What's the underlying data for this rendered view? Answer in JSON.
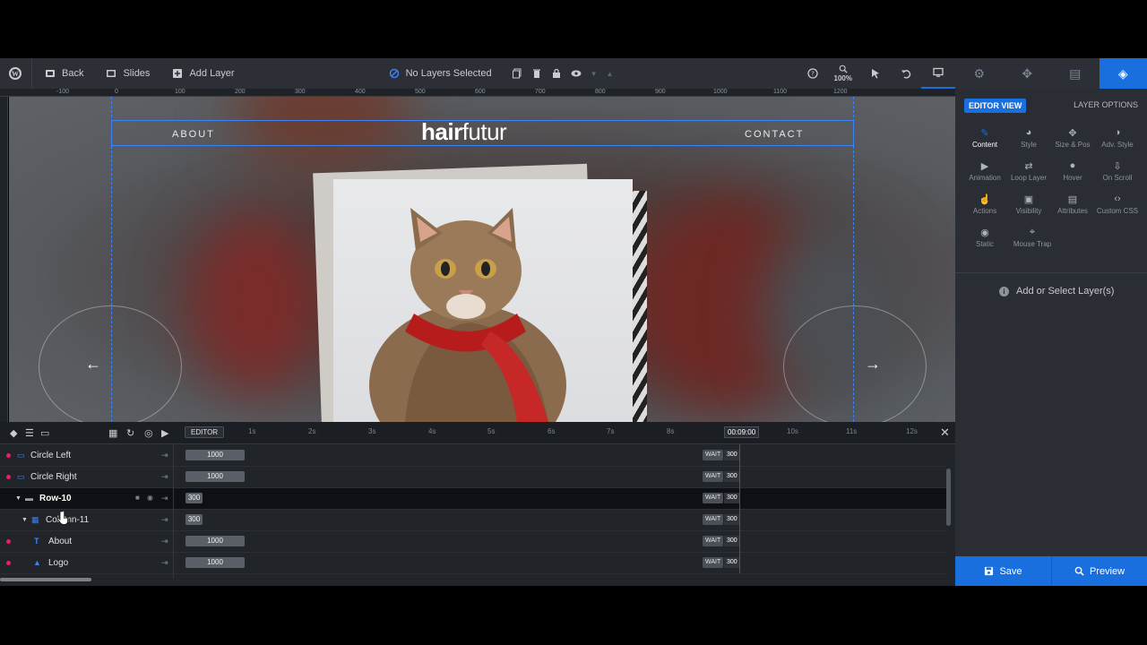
{
  "toolbar": {
    "back": "Back",
    "slides": "Slides",
    "add_layer": "Add Layer",
    "no_layers": "No Layers Selected",
    "zoom": "100%"
  },
  "ruler": {
    "ticks": [
      "-100",
      "0",
      "100",
      "200",
      "300",
      "400",
      "500",
      "600",
      "700",
      "800",
      "900",
      "1000",
      "1100",
      "1200"
    ]
  },
  "canvas": {
    "nav_about": "ABOUT",
    "nav_contact": "CONTACT",
    "logo_bold": "hair",
    "logo_light": "futur",
    "arrow_left": "←",
    "arrow_right": "→"
  },
  "timeline": {
    "editor": "EDITOR",
    "seconds": [
      "1s",
      "2s",
      "3s",
      "4s",
      "5s",
      "6s",
      "7s",
      "8s",
      "10s",
      "11s",
      "12s"
    ],
    "current_time": "00:09:00",
    "rows": [
      {
        "label": "Circle Left",
        "bar": "1000",
        "wait": "WAIT",
        "wait_value": "300"
      },
      {
        "label": "Circle Right",
        "bar": "1000",
        "wait": "WAIT",
        "wait_value": "300"
      },
      {
        "label": "Row-10",
        "bar": "300",
        "wait": "WAIT",
        "wait_value": "300"
      },
      {
        "label": "Column-11",
        "bar": "300",
        "wait": "WAIT",
        "wait_value": "300"
      },
      {
        "label": "About",
        "bar": "1000",
        "wait": "WAIT",
        "wait_value": "300"
      },
      {
        "label": "Logo",
        "bar": "1000",
        "wait": "WAIT",
        "wait_value": "300"
      }
    ]
  },
  "panel": {
    "editor_view": "EDITOR VIEW",
    "layer_options": "LAYER OPTIONS",
    "options": [
      "Content",
      "Style",
      "Size & Pos",
      "Adv. Style",
      "Animation",
      "Loop Layer",
      "Hover",
      "On Scroll",
      "Actions",
      "Visibility",
      "Attributes",
      "Custom CSS",
      "Static",
      "Mouse Trap"
    ],
    "add_select": "Add or Select Layer(s)",
    "save": "Save",
    "preview": "Preview"
  },
  "colors": {
    "accent": "#1a6fdf",
    "guide": "#3b82f6",
    "dot": "#e91e63"
  }
}
